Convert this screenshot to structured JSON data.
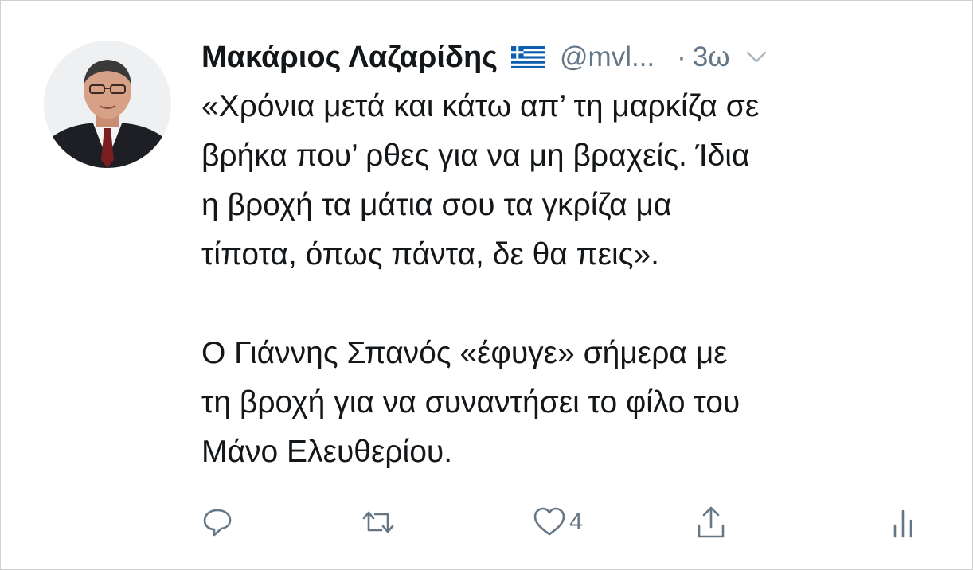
{
  "tweet": {
    "display_name": "Μακάριος Λαζαρίδης",
    "handle": "@mvl...",
    "separator": "·",
    "time": "3ω",
    "lines": [
      "«Χρόνια μετά και κάτω απ’ τη μαρκίζα σε",
      "βρήκα που’ ρθες για να μη βραχείς. Ίδια",
      "η βροχή τα μάτια σου τα γκρίζα μα",
      "τίποτα, όπως πάντα, δε θα πεις».",
      "Ο Γιάννης Σπανός «έφυγε» σήμερα με",
      "τη βροχή για να συναντήσει το φίλο του",
      "Μάνο Ελευθερίου."
    ],
    "likes_count": "4"
  },
  "icons": {
    "flag": "greek-flag-icon",
    "menu": "chevron-down-icon",
    "reply": "reply-icon",
    "retweet": "retweet-icon",
    "like": "heart-icon",
    "share": "share-icon",
    "analytics": "analytics-icon"
  },
  "colors": {
    "text": "#14171a",
    "secondary": "#657786",
    "flag_blue": "#0d5eaf"
  }
}
